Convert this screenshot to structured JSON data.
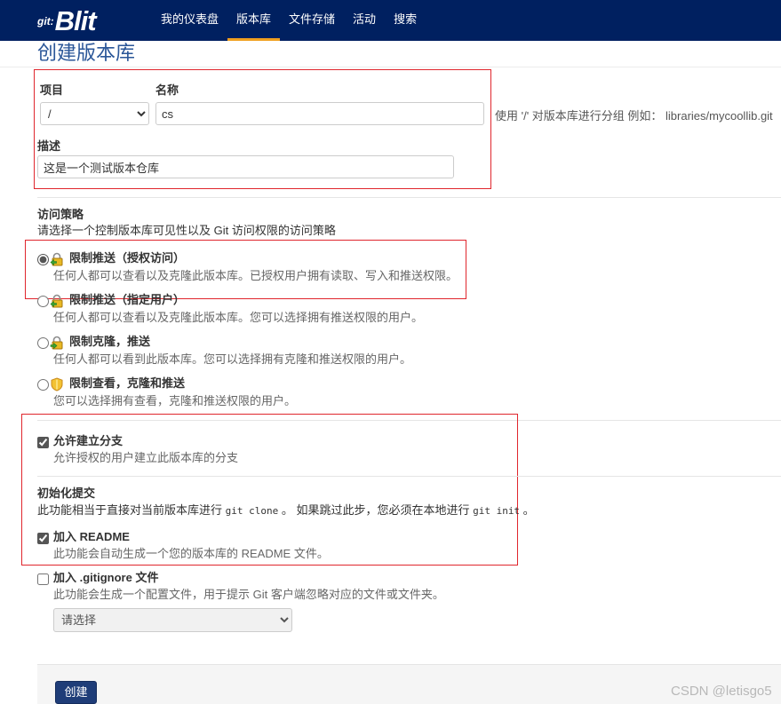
{
  "app": {
    "logo_prefix": "git:",
    "logo_text": "Blit"
  },
  "nav": {
    "items": [
      {
        "label": "我的仪表盘",
        "active": false
      },
      {
        "label": "版本库",
        "active": true
      },
      {
        "label": "文件存储",
        "active": false
      },
      {
        "label": "活动",
        "active": false
      },
      {
        "label": "搜索",
        "active": false
      }
    ]
  },
  "page": {
    "title": "创建版本库"
  },
  "form": {
    "project": {
      "label": "项目",
      "value": "/"
    },
    "name": {
      "label": "名称",
      "value": "cs",
      "hint": "使用 '/' 对版本库进行分组 例如： libraries/mycoollib.git"
    },
    "description": {
      "label": "描述",
      "value": "这是一个测试版本仓库"
    },
    "access_policy": {
      "title": "访问策略",
      "subtitle": "请选择一个控制版本库可见性以及 Git 访问权限的访问策略",
      "options": [
        {
          "label": "限制推送（授权访问）",
          "description": "任何人都可以查看以及克隆此版本库。已授权用户拥有读取、写入和推送权限。",
          "icon": "lock-go-icon",
          "selected": true
        },
        {
          "label": "限制推送（指定用户）",
          "description": "任何人都可以查看以及克隆此版本库。您可以选择拥有推送权限的用户。",
          "icon": "lock-go-icon",
          "selected": false
        },
        {
          "label": "限制克隆，推送",
          "description": "任何人都可以看到此版本库。您可以选择拥有克隆和推送权限的用户。",
          "icon": "lock-pull-icon",
          "selected": false
        },
        {
          "label": "限制查看，克隆和推送",
          "description": "您可以选择拥有查看，克隆和推送权限的用户。",
          "icon": "shield-icon",
          "selected": false
        }
      ]
    },
    "allow_forks": {
      "label": "允许建立分支",
      "description": "允许授权的用户建立此版本库的分支",
      "checked": true
    },
    "init_commit": {
      "title": "初始化提交",
      "text_1": "此功能相当于直接对当前版本库进行 ",
      "code_1": "git clone",
      "text_2": " 。 如果跳过此步，您必须在本地进行 ",
      "code_2": "git init",
      "text_3": " 。"
    },
    "add_readme": {
      "label": "加入 README",
      "description": "此功能会自动生成一个您的版本库的 README 文件。",
      "checked": true
    },
    "add_gitignore": {
      "label": "加入 .gitignore 文件",
      "description": "此功能会生成一个配置文件，用于提示 Git 客户端忽略对应的文件或文件夹。",
      "checked": false,
      "select_value": "请选择"
    },
    "create_button": "创建"
  },
  "watermark": "CSDN @letisgo5",
  "colors": {
    "navbar": "#002060",
    "accent": "#f0a020",
    "title": "#2a5698",
    "annotation": "#e0262d",
    "button": "#1f3d78"
  }
}
